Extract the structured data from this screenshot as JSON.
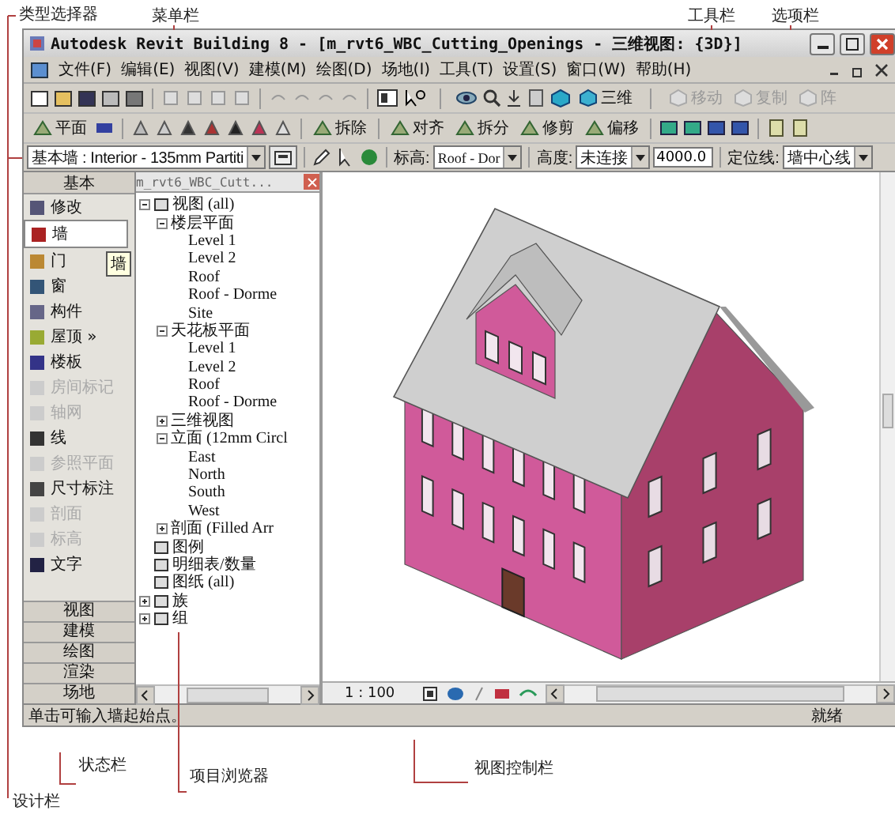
{
  "annotations_top": [
    "类型选择器",
    "菜单栏",
    "工具栏",
    "选项栏"
  ],
  "window": {
    "title": "Autodesk Revit Building 8 - [m_rvt6_WBC_Cutting_Openings - 三维视图: {3D}]"
  },
  "menu": [
    "文件(F)",
    "编辑(E)",
    "视图(V)",
    "建模(M)",
    "绘图(D)",
    "场地(I)",
    "工具(T)",
    "设置(S)",
    "窗口(W)",
    "帮助(H)"
  ],
  "toolbar_1": [
    {
      "label": "三维",
      "disabled": false
    },
    {
      "label": "移动",
      "disabled": true
    },
    {
      "label": "复制",
      "disabled": true
    },
    {
      "label": "阵",
      "disabled": true
    }
  ],
  "toolbar_2": [
    {
      "label": "平面",
      "disabled": false
    },
    {
      "label": "拆除",
      "disabled": false
    },
    {
      "label": "对齐",
      "disabled": false
    },
    {
      "label": "拆分",
      "disabled": false
    },
    {
      "label": "修剪",
      "disabled": false
    },
    {
      "label": "偏移",
      "disabled": false
    }
  ],
  "options_bar": {
    "type_selector": "基本墙 : Interior - 135mm Partiti",
    "level_label": "标高:",
    "level": "Roof - Dor",
    "height_label": "高度:",
    "height": "未连接",
    "height_value": "4000.0",
    "location_label": "定位线:",
    "location": "墙中心线"
  },
  "design_bar": {
    "header": "基本",
    "tooltip": "墙",
    "items": [
      {
        "label": "修改",
        "selected": false,
        "disabled": false
      },
      {
        "label": "墙",
        "selected": true,
        "disabled": false
      },
      {
        "label": "门",
        "selected": false,
        "disabled": false
      },
      {
        "label": "窗",
        "selected": false,
        "disabled": false
      },
      {
        "label": "构件",
        "selected": false,
        "disabled": false
      },
      {
        "label": "屋顶 »",
        "selected": false,
        "disabled": false
      },
      {
        "label": "楼板",
        "selected": false,
        "disabled": false
      },
      {
        "label": "房间标记",
        "selected": false,
        "disabled": true
      },
      {
        "label": "轴网",
        "selected": false,
        "disabled": true
      },
      {
        "label": "线",
        "selected": false,
        "disabled": false
      },
      {
        "label": "参照平面",
        "selected": false,
        "disabled": true
      },
      {
        "label": "尺寸标注",
        "selected": false,
        "disabled": false
      },
      {
        "label": "剖面",
        "selected": false,
        "disabled": true
      },
      {
        "label": "标高",
        "selected": false,
        "disabled": true
      },
      {
        "label": "文字",
        "selected": false,
        "disabled": false
      }
    ],
    "tabs": [
      "视图",
      "建模",
      "绘图",
      "渲染",
      "场地"
    ]
  },
  "project_browser": {
    "title": "m_rvt6_WBC_Cutt...",
    "tree": [
      {
        "label": "视图 (all)",
        "expanded": true,
        "children": [
          {
            "label": "楼层平面",
            "expanded": true,
            "children": [
              {
                "label": "Level 1"
              },
              {
                "label": "Level 2"
              },
              {
                "label": "Roof"
              },
              {
                "label": "Roof - Dorme"
              },
              {
                "label": "Site"
              }
            ]
          },
          {
            "label": "天花板平面",
            "expanded": true,
            "children": [
              {
                "label": "Level 1"
              },
              {
                "label": "Level 2"
              },
              {
                "label": "Roof"
              },
              {
                "label": "Roof - Dorme"
              }
            ]
          },
          {
            "label": "三维视图",
            "expanded": false
          },
          {
            "label": "立面 (12mm Circl",
            "expanded": true,
            "children": [
              {
                "label": "East"
              },
              {
                "label": "North"
              },
              {
                "label": "South"
              },
              {
                "label": "West"
              }
            ]
          },
          {
            "label": "剖面 (Filled Arr",
            "expanded": false
          }
        ]
      },
      {
        "label": "图例"
      },
      {
        "label": "明细表/数量"
      },
      {
        "label": "图纸 (all)"
      },
      {
        "label": "族",
        "expanded": false
      },
      {
        "label": "组",
        "expanded": false
      }
    ]
  },
  "view_control": {
    "scale": "1 : 100"
  },
  "status_bar": {
    "message": "单击可输入墙起始点。",
    "state": "就绪"
  },
  "annotations_bottom": [
    "状态栏",
    "项目浏览器",
    "视图控制栏",
    "设计栏"
  ]
}
